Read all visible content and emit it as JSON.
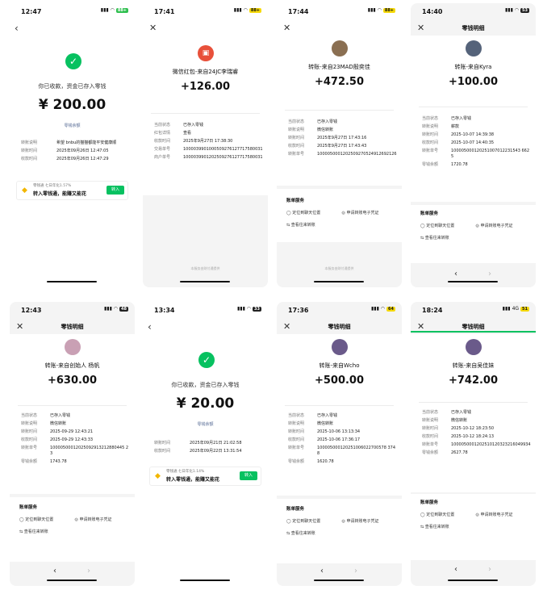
{
  "s1": {
    "time": "12:47",
    "battery": "88+",
    "received": "你已收款，资金已存入零钱",
    "amount": "¥ 200.00",
    "link": "零钱余额",
    "rows": [
      {
        "k": "转账说明",
        "v": "希望 bnbu的猫猫都能平安健康顺"
      },
      {
        "k": "转账时间",
        "v": "2025年09月26日 12:47:05"
      },
      {
        "k": "收款时间",
        "v": "2025年09月26日 12:47:29"
      }
    ],
    "card": {
      "line1": "零钱通 七日年化1.57%",
      "line2": "转入零钱通，能赚又能花",
      "btn": "转入"
    }
  },
  "s2": {
    "time": "17:41",
    "battery": "88+",
    "sender": "微信红包-来自24JC李瑞睿",
    "amount": "+126.00",
    "rows": [
      {
        "k": "当前状态",
        "v": "已存入零钱"
      },
      {
        "k": "红包详情",
        "v": "查看"
      },
      {
        "k": "收款时间",
        "v": "2025年9月27日 17:38:30"
      },
      {
        "k": "交易单号",
        "v": "1000039901000509276127717580031"
      },
      {
        "k": "商户单号",
        "v": "1000039901202509276127717580031"
      }
    ],
    "note": "本服务由财付通提供"
  },
  "s3": {
    "time": "17:44",
    "battery": "88+",
    "sender": "转账-来自23MAD殷奕佳",
    "amount": "+472.50",
    "rows": [
      {
        "k": "当前状态",
        "v": "已存入零钱"
      },
      {
        "k": "转账说明",
        "v": "微信转账"
      },
      {
        "k": "转账时间",
        "v": "2025年9月27日 17:43:16"
      },
      {
        "k": "收款时间",
        "v": "2025年9月27日 17:43:43"
      },
      {
        "k": "转账单号",
        "v": "1000050001202509270524912692126"
      }
    ],
    "svc_title": "账单服务",
    "svc1": "定位到聊天位置",
    "svc2": "申请转账电子凭证",
    "svc3": "查看往来转账",
    "note": "本服务由财付通提供"
  },
  "s4": {
    "time": "14:40",
    "battery": "53",
    "title": "零钱明细",
    "sender": "转账-来自Kyra",
    "amount": "+100.00",
    "rows": [
      {
        "k": "当前状态",
        "v": "已存入零钱"
      },
      {
        "k": "转账说明",
        "v": "薪款"
      },
      {
        "k": "转账时间",
        "v": "2025-10-07 14:39:38"
      },
      {
        "k": "收款时间",
        "v": "2025-10-07 14:40:35"
      },
      {
        "k": "转账单号",
        "v": "100005000120251007012231543 6625"
      },
      {
        "k": "零钱余额",
        "v": "1720.78"
      }
    ],
    "svc_title": "账单服务",
    "svc1": "定位到聊天位置",
    "svc2": "申请转账电子凭证",
    "svc3": "查看往来转账"
  },
  "s5": {
    "time": "12:43",
    "battery": "48",
    "title": "零钱明细",
    "sender": "转账-来自创始人 杨帆",
    "amount": "+630.00",
    "rows": [
      {
        "k": "当前状态",
        "v": "已存入零钱"
      },
      {
        "k": "转账说明",
        "v": "微信转账"
      },
      {
        "k": "转账时间",
        "v": "2025-09-29 12:43:21"
      },
      {
        "k": "收款时间",
        "v": "2025-09-29 12:43:33"
      },
      {
        "k": "转账单号",
        "v": "10000500012025092913212880445 23"
      },
      {
        "k": "零钱余额",
        "v": "1743.78"
      }
    ],
    "svc_title": "账单服务",
    "svc1": "定位到聊天位置",
    "svc2": "申请转账电子凭证",
    "svc3": "查看往来转账"
  },
  "s6": {
    "time": "13:34",
    "battery": "33",
    "received": "你已收款，资金已存入零钱",
    "amount": "¥ 20.00",
    "link": "零钱余额",
    "rows": [
      {
        "k": "转账时间",
        "v": "2025年09月21日 21:02:58"
      },
      {
        "k": "收款时间",
        "v": "2025年09月22日 13:31:54"
      }
    ],
    "card": {
      "line1": "零钱通 七日年化1.14%",
      "line2": "转入零钱通，能赚又能花",
      "btn": "转入"
    }
  },
  "s7": {
    "time": "17:36",
    "battery": "64",
    "title": "零钱明细",
    "sender": "转账-来自Wcho",
    "amount": "+500.00",
    "rows": [
      {
        "k": "当前状态",
        "v": "已存入零钱"
      },
      {
        "k": "转账说明",
        "v": "微信转账"
      },
      {
        "k": "转账时间",
        "v": "2025-10-06 13:13:34"
      },
      {
        "k": "收款时间",
        "v": "2025-10-06 17:36:17"
      },
      {
        "k": "转账单号",
        "v": "100005000120251006022700578 3748"
      },
      {
        "k": "零钱余额",
        "v": "1620.78"
      }
    ],
    "svc_title": "账单服务",
    "svc1": "定位到聊天位置",
    "svc2": "申请转账电子凭证",
    "svc3": "查看往来转账"
  },
  "s8": {
    "time": "18:24",
    "battery": "51",
    "net": "4G",
    "title": "零钱明细",
    "sender": "转账-来自吴佳妹",
    "amount": "+742.00",
    "rows": [
      {
        "k": "当前状态",
        "v": "已存入零钱"
      },
      {
        "k": "转账说明",
        "v": "微信转账"
      },
      {
        "k": "转账时间",
        "v": "2025-10-12 18:23:50"
      },
      {
        "k": "收款时间",
        "v": "2025-10-12 18:24:13"
      },
      {
        "k": "转账单号",
        "v": "1000050001202510120323216049934"
      },
      {
        "k": "零钱余额",
        "v": "2627.78"
      }
    ],
    "svc_title": "账单服务",
    "svc1": "定位到聊天位置",
    "svc2": "申请转账电子凭证",
    "svc3": "查看往来转账"
  }
}
